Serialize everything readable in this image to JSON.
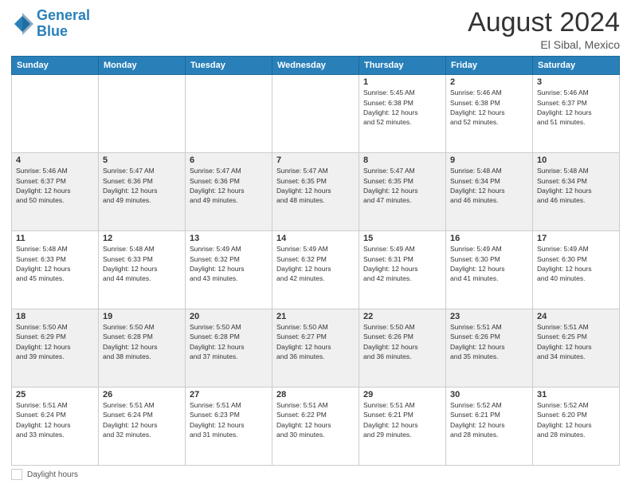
{
  "header": {
    "logo_line1": "General",
    "logo_line2": "Blue",
    "main_title": "August 2024",
    "subtitle": "El Sibal, Mexico"
  },
  "days_of_week": [
    "Sunday",
    "Monday",
    "Tuesday",
    "Wednesday",
    "Thursday",
    "Friday",
    "Saturday"
  ],
  "footer": {
    "label": "Daylight hours"
  },
  "weeks": [
    [
      {
        "day": "",
        "info": ""
      },
      {
        "day": "",
        "info": ""
      },
      {
        "day": "",
        "info": ""
      },
      {
        "day": "",
        "info": ""
      },
      {
        "day": "1",
        "info": "Sunrise: 5:45 AM\nSunset: 6:38 PM\nDaylight: 12 hours\nand 52 minutes."
      },
      {
        "day": "2",
        "info": "Sunrise: 5:46 AM\nSunset: 6:38 PM\nDaylight: 12 hours\nand 52 minutes."
      },
      {
        "day": "3",
        "info": "Sunrise: 5:46 AM\nSunset: 6:37 PM\nDaylight: 12 hours\nand 51 minutes."
      }
    ],
    [
      {
        "day": "4",
        "info": "Sunrise: 5:46 AM\nSunset: 6:37 PM\nDaylight: 12 hours\nand 50 minutes."
      },
      {
        "day": "5",
        "info": "Sunrise: 5:47 AM\nSunset: 6:36 PM\nDaylight: 12 hours\nand 49 minutes."
      },
      {
        "day": "6",
        "info": "Sunrise: 5:47 AM\nSunset: 6:36 PM\nDaylight: 12 hours\nand 49 minutes."
      },
      {
        "day": "7",
        "info": "Sunrise: 5:47 AM\nSunset: 6:35 PM\nDaylight: 12 hours\nand 48 minutes."
      },
      {
        "day": "8",
        "info": "Sunrise: 5:47 AM\nSunset: 6:35 PM\nDaylight: 12 hours\nand 47 minutes."
      },
      {
        "day": "9",
        "info": "Sunrise: 5:48 AM\nSunset: 6:34 PM\nDaylight: 12 hours\nand 46 minutes."
      },
      {
        "day": "10",
        "info": "Sunrise: 5:48 AM\nSunset: 6:34 PM\nDaylight: 12 hours\nand 46 minutes."
      }
    ],
    [
      {
        "day": "11",
        "info": "Sunrise: 5:48 AM\nSunset: 6:33 PM\nDaylight: 12 hours\nand 45 minutes."
      },
      {
        "day": "12",
        "info": "Sunrise: 5:48 AM\nSunset: 6:33 PM\nDaylight: 12 hours\nand 44 minutes."
      },
      {
        "day": "13",
        "info": "Sunrise: 5:49 AM\nSunset: 6:32 PM\nDaylight: 12 hours\nand 43 minutes."
      },
      {
        "day": "14",
        "info": "Sunrise: 5:49 AM\nSunset: 6:32 PM\nDaylight: 12 hours\nand 42 minutes."
      },
      {
        "day": "15",
        "info": "Sunrise: 5:49 AM\nSunset: 6:31 PM\nDaylight: 12 hours\nand 42 minutes."
      },
      {
        "day": "16",
        "info": "Sunrise: 5:49 AM\nSunset: 6:30 PM\nDaylight: 12 hours\nand 41 minutes."
      },
      {
        "day": "17",
        "info": "Sunrise: 5:49 AM\nSunset: 6:30 PM\nDaylight: 12 hours\nand 40 minutes."
      }
    ],
    [
      {
        "day": "18",
        "info": "Sunrise: 5:50 AM\nSunset: 6:29 PM\nDaylight: 12 hours\nand 39 minutes."
      },
      {
        "day": "19",
        "info": "Sunrise: 5:50 AM\nSunset: 6:28 PM\nDaylight: 12 hours\nand 38 minutes."
      },
      {
        "day": "20",
        "info": "Sunrise: 5:50 AM\nSunset: 6:28 PM\nDaylight: 12 hours\nand 37 minutes."
      },
      {
        "day": "21",
        "info": "Sunrise: 5:50 AM\nSunset: 6:27 PM\nDaylight: 12 hours\nand 36 minutes."
      },
      {
        "day": "22",
        "info": "Sunrise: 5:50 AM\nSunset: 6:26 PM\nDaylight: 12 hours\nand 36 minutes."
      },
      {
        "day": "23",
        "info": "Sunrise: 5:51 AM\nSunset: 6:26 PM\nDaylight: 12 hours\nand 35 minutes."
      },
      {
        "day": "24",
        "info": "Sunrise: 5:51 AM\nSunset: 6:25 PM\nDaylight: 12 hours\nand 34 minutes."
      }
    ],
    [
      {
        "day": "25",
        "info": "Sunrise: 5:51 AM\nSunset: 6:24 PM\nDaylight: 12 hours\nand 33 minutes."
      },
      {
        "day": "26",
        "info": "Sunrise: 5:51 AM\nSunset: 6:24 PM\nDaylight: 12 hours\nand 32 minutes."
      },
      {
        "day": "27",
        "info": "Sunrise: 5:51 AM\nSunset: 6:23 PM\nDaylight: 12 hours\nand 31 minutes."
      },
      {
        "day": "28",
        "info": "Sunrise: 5:51 AM\nSunset: 6:22 PM\nDaylight: 12 hours\nand 30 minutes."
      },
      {
        "day": "29",
        "info": "Sunrise: 5:51 AM\nSunset: 6:21 PM\nDaylight: 12 hours\nand 29 minutes."
      },
      {
        "day": "30",
        "info": "Sunrise: 5:52 AM\nSunset: 6:21 PM\nDaylight: 12 hours\nand 28 minutes."
      },
      {
        "day": "31",
        "info": "Sunrise: 5:52 AM\nSunset: 6:20 PM\nDaylight: 12 hours\nand 28 minutes."
      }
    ]
  ]
}
